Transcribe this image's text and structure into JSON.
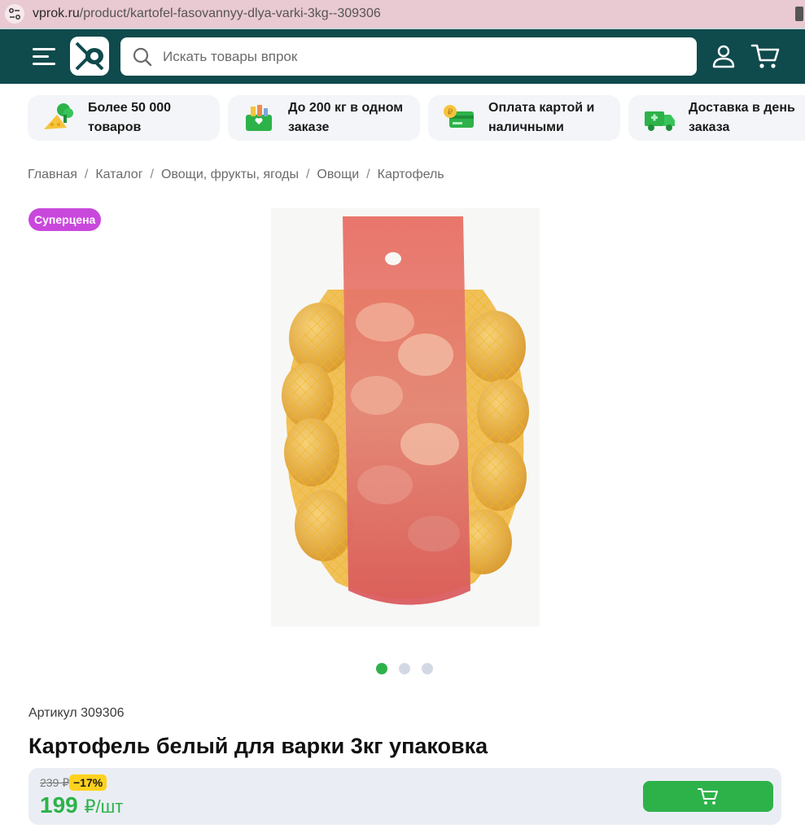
{
  "browser": {
    "url_domain": "vprok.ru",
    "url_path": "/product/kartofel-fasovannyy-dlya-varki-3kg--309306"
  },
  "header": {
    "search_placeholder": "Искать товары впрок",
    "icons": [
      "menu-icon",
      "logo",
      "search-icon",
      "user-icon",
      "cart-icon"
    ],
    "bg_color": "#0f4a4c"
  },
  "features": [
    {
      "label": "Более 50 000 товаров",
      "icon": "cheese-broccoli-icon"
    },
    {
      "label": "До 200 кг в одном заказе",
      "icon": "grocery-box-icon"
    },
    {
      "label": "Оплата картой и наличными",
      "icon": "card-coin-icon"
    },
    {
      "label": "Доставка в день заказа",
      "icon": "delivery-truck-icon"
    }
  ],
  "breadcrumb": [
    "Главная",
    "Каталог",
    "Овощи, фрукты, ягоды",
    "Овощи",
    "Картофель"
  ],
  "badge": {
    "label": "Суперцена",
    "color": "#c948dc"
  },
  "gallery": {
    "count": 3,
    "active_index": 0
  },
  "product": {
    "article": "Артикул 309306",
    "title": "Картофель белый для варки 3кг упаковка",
    "old_price": "239 ₽",
    "discount": "−17%",
    "price": "199",
    "price_unit": "₽/шт"
  },
  "colors": {
    "accent_green": "#2db24a",
    "discount_yellow": "#ffd21e"
  }
}
